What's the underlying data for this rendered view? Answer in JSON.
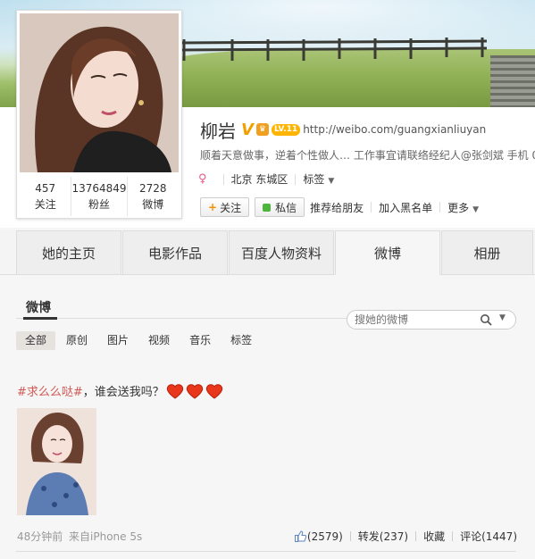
{
  "profile": {
    "name": "柳岩",
    "verified_badge": "V",
    "level_badge": "LV.11",
    "url": "http://weibo.com/guangxianliuyan",
    "bio": "顺着天意做事，逆着个性做人… 工作事宜请联络经纪人@张剑斌 手机 0",
    "gender_icon": "female-icon",
    "location": "北京 东城区",
    "tags_label": "标签",
    "stats": [
      {
        "value": "457",
        "label": "关注"
      },
      {
        "value": "13764849",
        "label": "粉丝"
      },
      {
        "value": "2728",
        "label": "微博"
      }
    ],
    "actions": {
      "follow": "关注",
      "message": "私信",
      "recommend": "推荐给朋友",
      "blacklist": "加入黑名单",
      "more": "更多"
    }
  },
  "tabs": [
    {
      "label": "她的主页",
      "active": false
    },
    {
      "label": "电影作品",
      "active": false
    },
    {
      "label": "百度人物资料",
      "active": false
    },
    {
      "label": "微博",
      "active": true
    },
    {
      "label": "相册",
      "active": false
    }
  ],
  "feed": {
    "title": "微博",
    "search_placeholder": "搜她的微博",
    "filters": [
      {
        "label": "全部",
        "active": true
      },
      {
        "label": "原创",
        "active": false
      },
      {
        "label": "图片",
        "active": false
      },
      {
        "label": "视频",
        "active": false
      },
      {
        "label": "音乐",
        "active": false
      },
      {
        "label": "标签",
        "active": false
      }
    ]
  },
  "post": {
    "hashtag": "#求么么哒#",
    "text": "，谁会送我吗？",
    "time": "48分钟前",
    "source_prefix": "来自",
    "source_device": "iPhone 5s",
    "likes": "(2579)",
    "repost": "转发(237)",
    "favorite": "收藏",
    "comment": "评论(1447)"
  },
  "colors": {
    "hashtag": "#d05a55",
    "verified": "#f1a000",
    "follow_plus": "#f29100",
    "message_dot": "#4db53c"
  }
}
